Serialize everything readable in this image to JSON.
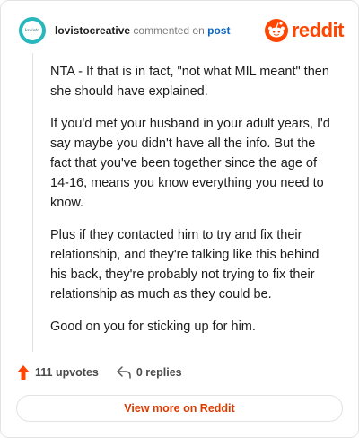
{
  "header": {
    "avatar_text": "lovisto",
    "username": "lovistocreative",
    "commented_on": "commented on",
    "post_link": "post",
    "brand_name": "reddit"
  },
  "comment": {
    "paragraphs": [
      "NTA - If that is in fact, \"not what MIL meant\" then she should have explained.",
      "If you'd met your husband in your adult years, I'd say maybe you didn't have all the info. But the fact that you've been together since the age of 14-16, means you know everything you need to know.",
      "Plus if they contacted him to try and fix their relationship, and they're talking like this behind his back, they're probably not trying to fix their relationship as much as they could be.",
      "Good on you for sticking up for him."
    ]
  },
  "footer": {
    "upvotes": "111 upvotes",
    "replies": "0 replies",
    "view_more": "View more on Reddit"
  },
  "colors": {
    "brand": "#ff4500",
    "upvote": "#ff4500",
    "link": "#0a66c2",
    "view_more_text": "#d93a00",
    "avatar": "#28b7bd"
  },
  "icons": {
    "brand": "reddit-logo-icon",
    "upvote": "upvote-arrow-icon",
    "reply": "reply-arrow-icon"
  }
}
